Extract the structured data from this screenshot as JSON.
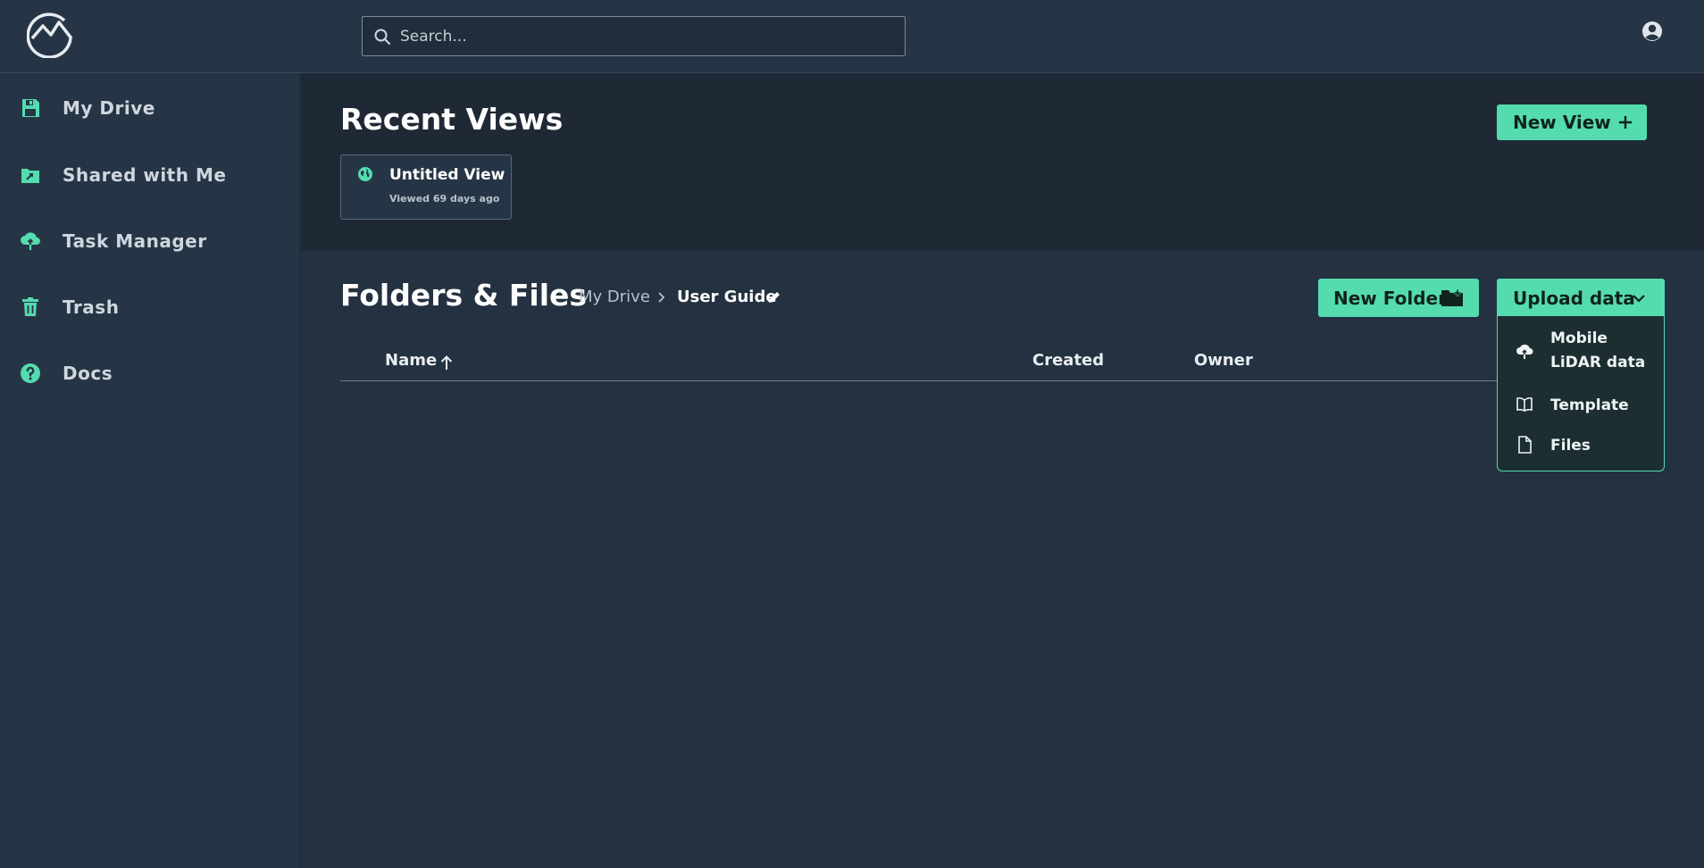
{
  "header": {
    "search_placeholder": "Search..."
  },
  "sidebar": {
    "items": [
      {
        "label": "My Drive",
        "icon": "floppy-disk-icon"
      },
      {
        "label": "Shared with Me",
        "icon": "shared-folder-icon"
      },
      {
        "label": "Task Manager",
        "icon": "cloud-upload-icon"
      },
      {
        "label": "Trash",
        "icon": "trash-icon"
      },
      {
        "label": "Docs",
        "icon": "help-circle-icon"
      }
    ]
  },
  "recent": {
    "title": "Recent Views",
    "new_view_label": "New View",
    "views": [
      {
        "title": "Untitled View",
        "subtitle": "Viewed 69 days ago"
      }
    ]
  },
  "files": {
    "title": "Folders & Files",
    "breadcrumb": [
      "My Drive",
      "User Guide"
    ],
    "new_folder_label": "New Folder",
    "upload_label": "Upload data",
    "columns": [
      "Name",
      "Created",
      "Owner"
    ],
    "upload_menu": [
      {
        "label_line1": "Mobile",
        "label_line2": "LiDAR data",
        "icon": "cloud-upload-icon"
      },
      {
        "label_line1": "Template",
        "icon": "book-icon"
      },
      {
        "label_line1": "Files",
        "icon": "file-icon"
      }
    ]
  },
  "colors": {
    "accent": "#54dcaf",
    "background": "#243140",
    "sidebar": "#263545"
  }
}
